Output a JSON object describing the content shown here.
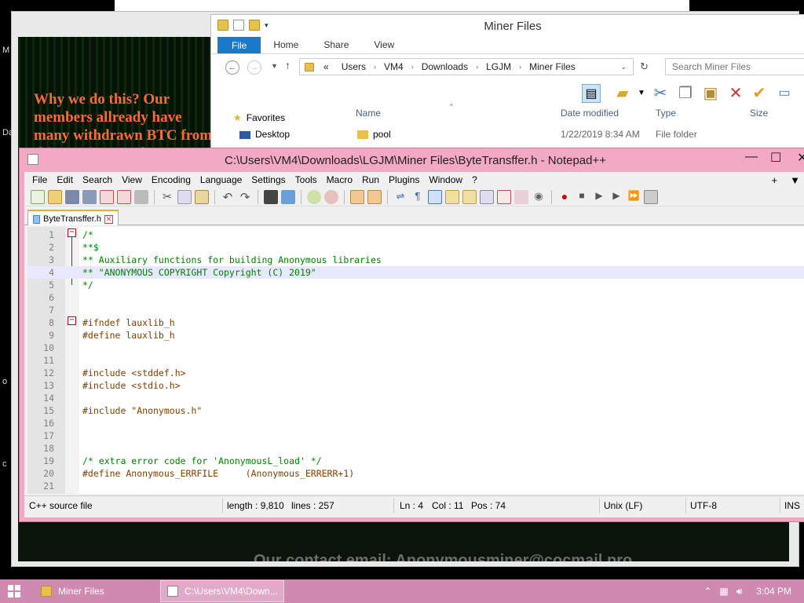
{
  "desktop": {
    "image_text": "Why we do this? Our members allready have many withdrawn BTC from this precious Tools.",
    "footer_text": "Our contact email: Anonymousminer@cocmail.pro",
    "left_letters": [
      "M",
      "Da",
      "o",
      "c"
    ]
  },
  "explorer": {
    "title": "Miner Files",
    "ribbon_tabs": [
      "File",
      "Home",
      "Share",
      "View"
    ],
    "address": {
      "prefix": "«",
      "crumbs": [
        "Users",
        "VM4",
        "Downloads",
        "LGJM",
        "Miner Files"
      ]
    },
    "search_placeholder": "Search Miner Files",
    "nav": {
      "favorites": "Favorites",
      "desktop": "Desktop"
    },
    "columns": [
      "Name",
      "Date modified",
      "Type",
      "Size"
    ],
    "rows": [
      {
        "name": "pool",
        "date": "1/22/2019 8:34 AM",
        "type": "File folder"
      }
    ]
  },
  "npp": {
    "title": "C:\\Users\\VM4\\Downloads\\LGJM\\Miner Files\\ByteTransffer.h - Notepad++",
    "menu": [
      "File",
      "Edit",
      "Search",
      "View",
      "Encoding",
      "Language",
      "Settings",
      "Tools",
      "Macro",
      "Run",
      "Plugins",
      "Window",
      "?"
    ],
    "menu_right": [
      "+",
      "▼"
    ],
    "tab_name": "ByteTransffer.h",
    "lines": [
      {
        "n": "1",
        "text": "/*",
        "kind": "comment"
      },
      {
        "n": "2",
        "text": "**$",
        "kind": "comment"
      },
      {
        "n": "3",
        "text": "** Auxiliary functions for building Anonymous libraries",
        "kind": "comment"
      },
      {
        "n": "4",
        "text": "** \"ANONYMOUS COPYRIGHT Copyright (C) 2019\"",
        "kind": "comment"
      },
      {
        "n": "5",
        "text": "*/",
        "kind": "comment"
      },
      {
        "n": "6",
        "text": "",
        "kind": "plain"
      },
      {
        "n": "7",
        "text": "",
        "kind": "plain"
      },
      {
        "n": "8",
        "text": "#ifndef lauxlib_h",
        "kind": "pre"
      },
      {
        "n": "9",
        "text": "#define lauxlib_h",
        "kind": "pre"
      },
      {
        "n": "10",
        "text": "",
        "kind": "plain"
      },
      {
        "n": "11",
        "text": "",
        "kind": "plain"
      },
      {
        "n": "12",
        "text": "#include <stddef.h>",
        "kind": "pre"
      },
      {
        "n": "13",
        "text": "#include <stdio.h>",
        "kind": "pre"
      },
      {
        "n": "14",
        "text": "",
        "kind": "plain"
      },
      {
        "n": "15",
        "text": "#include \"Anonymous.h\"",
        "kind": "pre"
      },
      {
        "n": "16",
        "text": "",
        "kind": "plain"
      },
      {
        "n": "17",
        "text": "",
        "kind": "plain"
      },
      {
        "n": "18",
        "text": "",
        "kind": "plain"
      },
      {
        "n": "19",
        "text": "/* extra error code for 'AnonymousL_load' */",
        "kind": "comment"
      },
      {
        "n": "20",
        "text": "#define Anonymous_ERRFILE     (Anonymous_ERRERR+1)",
        "kind": "pre"
      },
      {
        "n": "21",
        "text": "",
        "kind": "plain"
      }
    ],
    "current_line": 4,
    "status": {
      "file_type": "C++ source file",
      "length": "length : 9,810",
      "lines": "lines : 257",
      "ln": "Ln : 4",
      "col": "Col : 11",
      "pos": "Pos : 74",
      "eol": "Unix (LF)",
      "encoding": "UTF-8",
      "mode": "INS"
    }
  },
  "taskbar": {
    "items": [
      "Miner Files",
      "C:\\Users\\VM4\\Down..."
    ],
    "time": "3:04 PM"
  }
}
